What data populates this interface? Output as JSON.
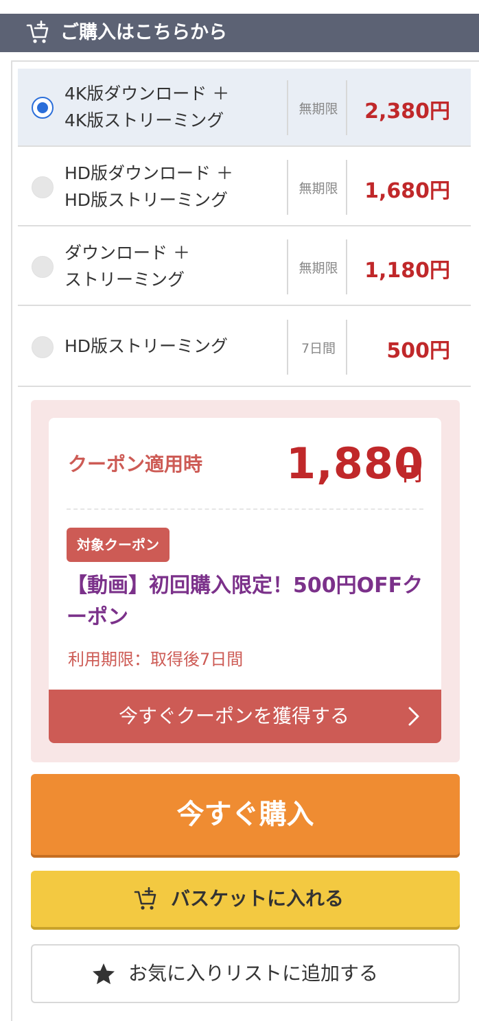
{
  "header": {
    "title": "ご購入はこちらから",
    "icon": "cart-add-icon"
  },
  "options": [
    {
      "line1": "4K版ダウンロード ＋",
      "line2": "4K版ストリーミング",
      "period": "無期限",
      "price": "2,380円",
      "selected": true
    },
    {
      "line1": "HD版ダウンロード ＋",
      "line2": "HD版ストリーミング",
      "period": "無期限",
      "price": "1,680円",
      "selected": false
    },
    {
      "line1": "ダウンロード ＋",
      "line2": "ストリーミング",
      "period": "無期限",
      "price": "1,180円",
      "selected": false
    },
    {
      "line1": "HD版ストリーミング",
      "line2": "",
      "period": "7日間",
      "price": "500円",
      "selected": false
    }
  ],
  "coupon": {
    "label": "クーポン適用時",
    "price": "1,880",
    "unit": "円",
    "badge": "対象クーポン",
    "title": "【動画】初回購入限定！500円OFFクーポン",
    "expiry": "利用期限：取得後7日間",
    "button_label": "今すぐクーポンを獲得する"
  },
  "buy_button": {
    "label": "今すぐ購入"
  },
  "basket_button": {
    "label": "バスケットに入れる",
    "icon": "cart-add-icon"
  },
  "favorite_button": {
    "label": "お気に入りリストに追加する",
    "icon": "star-icon"
  },
  "colors": {
    "header_bg": "#5c6274",
    "selected_bg": "#e9eef5",
    "radio_accent": "#2b6ed9",
    "price_red": "#c0282a",
    "coupon_red": "#cd5b55",
    "coupon_title_purple": "#7b318a",
    "buy_orange": "#ef8c32",
    "basket_yellow": "#f3c941"
  }
}
